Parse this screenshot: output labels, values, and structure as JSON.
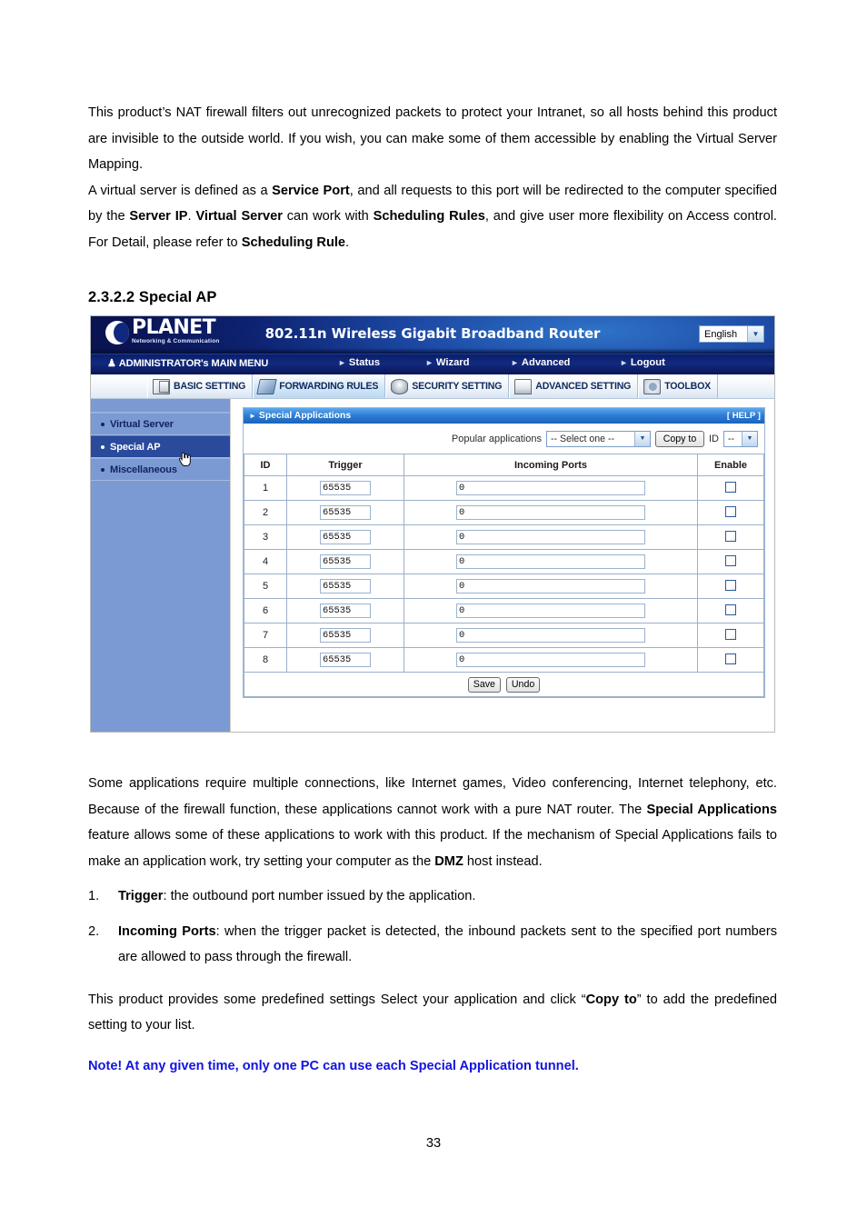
{
  "document": {
    "paragraph_1_parts": [
      {
        "t": "This product’s NAT firewall filters out unrecognized packets to protect your Intranet, so all hosts behind this product are invisible to the outside world. If you wish, you can make some of them accessible by enabling the Virtual Server Mapping.",
        "b": false
      }
    ],
    "paragraph_1": "This product’s NAT firewall filters out unrecognized packets to protect your Intranet, so all hosts behind this product are invisible to the outside world. If you wish, you can make some of them accessible by enabling the Virtual Server Mapping.",
    "p2_a": "A virtual server is defined as a ",
    "p2_b1": "Service Port",
    "p2_b": ", and all requests to this port will be redirected to the computer specified by the ",
    "p2_b2": "Server IP",
    "p2_c": ". ",
    "p2_b3": "Virtual Server",
    "p2_d": " can work with ",
    "p2_b4": "Scheduling Rules",
    "p2_e": ", and give user more flexibility on Access control. For Detail, please refer to ",
    "p2_b5": "Scheduling Rule",
    "p2_f": ".",
    "section_title": "2.3.2.2 Special AP",
    "p3_a": "Some applications require multiple connections, like Internet games, Video conferencing, Internet telephony, etc. Because of the firewall function, these applications cannot work with a pure NAT router. The ",
    "p3_b1": "Special Applications",
    "p3_b": " feature allows some of these applications to work with this product. If the mechanism of Special Applications fails to make an application work, try setting your computer as the ",
    "p3_b2": "DMZ",
    "p3_c": " host instead.",
    "list": [
      {
        "num": "1.",
        "bold": "Trigger",
        "rest": ": the outbound port number issued by the application."
      },
      {
        "num": "2.",
        "bold": "Incoming Ports",
        "rest": ": when the trigger packet is detected, the inbound packets sent to the specified port numbers are allowed to pass through the firewall."
      }
    ],
    "p4_a": "This product provides some predefined settings Select your application and click “",
    "p4_b1": "Copy to",
    "p4_b": "” to add the predefined setting to your list.",
    "note": "Note! At any given time, only one PC can use each Special Application tunnel.",
    "note_color": "#1414e0",
    "page_number": "33"
  },
  "router": {
    "header": {
      "logo_text": "PLANET",
      "logo_sub": "Networking & Communication",
      "title": "802.11n Wireless Gigabit Broadband Router",
      "language": "English"
    },
    "mainmenu": {
      "admin": "ADMINISTRATOR's MAIN MENU",
      "items": [
        "Status",
        "Wizard",
        "Advanced",
        "Logout"
      ]
    },
    "tabs": [
      {
        "label": "BASIC SETTING",
        "icon": "book-icon",
        "active": false
      },
      {
        "label": "FORWARDING RULES",
        "icon": "forwarding-icon",
        "active": true
      },
      {
        "label": "SECURITY SETTING",
        "icon": "shield-icon",
        "active": false
      },
      {
        "label": "ADVANCED SETTING",
        "icon": "advanced-icon",
        "active": false
      },
      {
        "label": "TOOLBOX",
        "icon": "toolbox-icon",
        "active": false
      }
    ],
    "sidebar": {
      "items": [
        {
          "label": "Virtual Server",
          "active": false
        },
        {
          "label": "Special AP",
          "active": true
        },
        {
          "label": "Miscellaneous",
          "active": false
        }
      ]
    },
    "panel": {
      "title": "Special Applications",
      "help": "[ HELP ]",
      "popular_label": "Popular applications",
      "popular_value": "-- Select one --",
      "copy_button": "Copy to",
      "id_label": "ID",
      "id_value": "--",
      "columns": [
        "ID",
        "Trigger",
        "Incoming Ports",
        "Enable"
      ],
      "rows": [
        {
          "id": "1",
          "trigger": "65535",
          "ports": "0",
          "enabled": false
        },
        {
          "id": "2",
          "trigger": "65535",
          "ports": "0",
          "enabled": false
        },
        {
          "id": "3",
          "trigger": "65535",
          "ports": "0",
          "enabled": false
        },
        {
          "id": "4",
          "trigger": "65535",
          "ports": "0",
          "enabled": false
        },
        {
          "id": "5",
          "trigger": "65535",
          "ports": "0",
          "enabled": false
        },
        {
          "id": "6",
          "trigger": "65535",
          "ports": "0",
          "enabled": false
        },
        {
          "id": "7",
          "trigger": "65535",
          "ports": "0",
          "enabled": false
        },
        {
          "id": "8",
          "trigger": "65535",
          "ports": "0",
          "enabled": false
        }
      ],
      "save_button": "Save",
      "undo_button": "Undo"
    }
  }
}
